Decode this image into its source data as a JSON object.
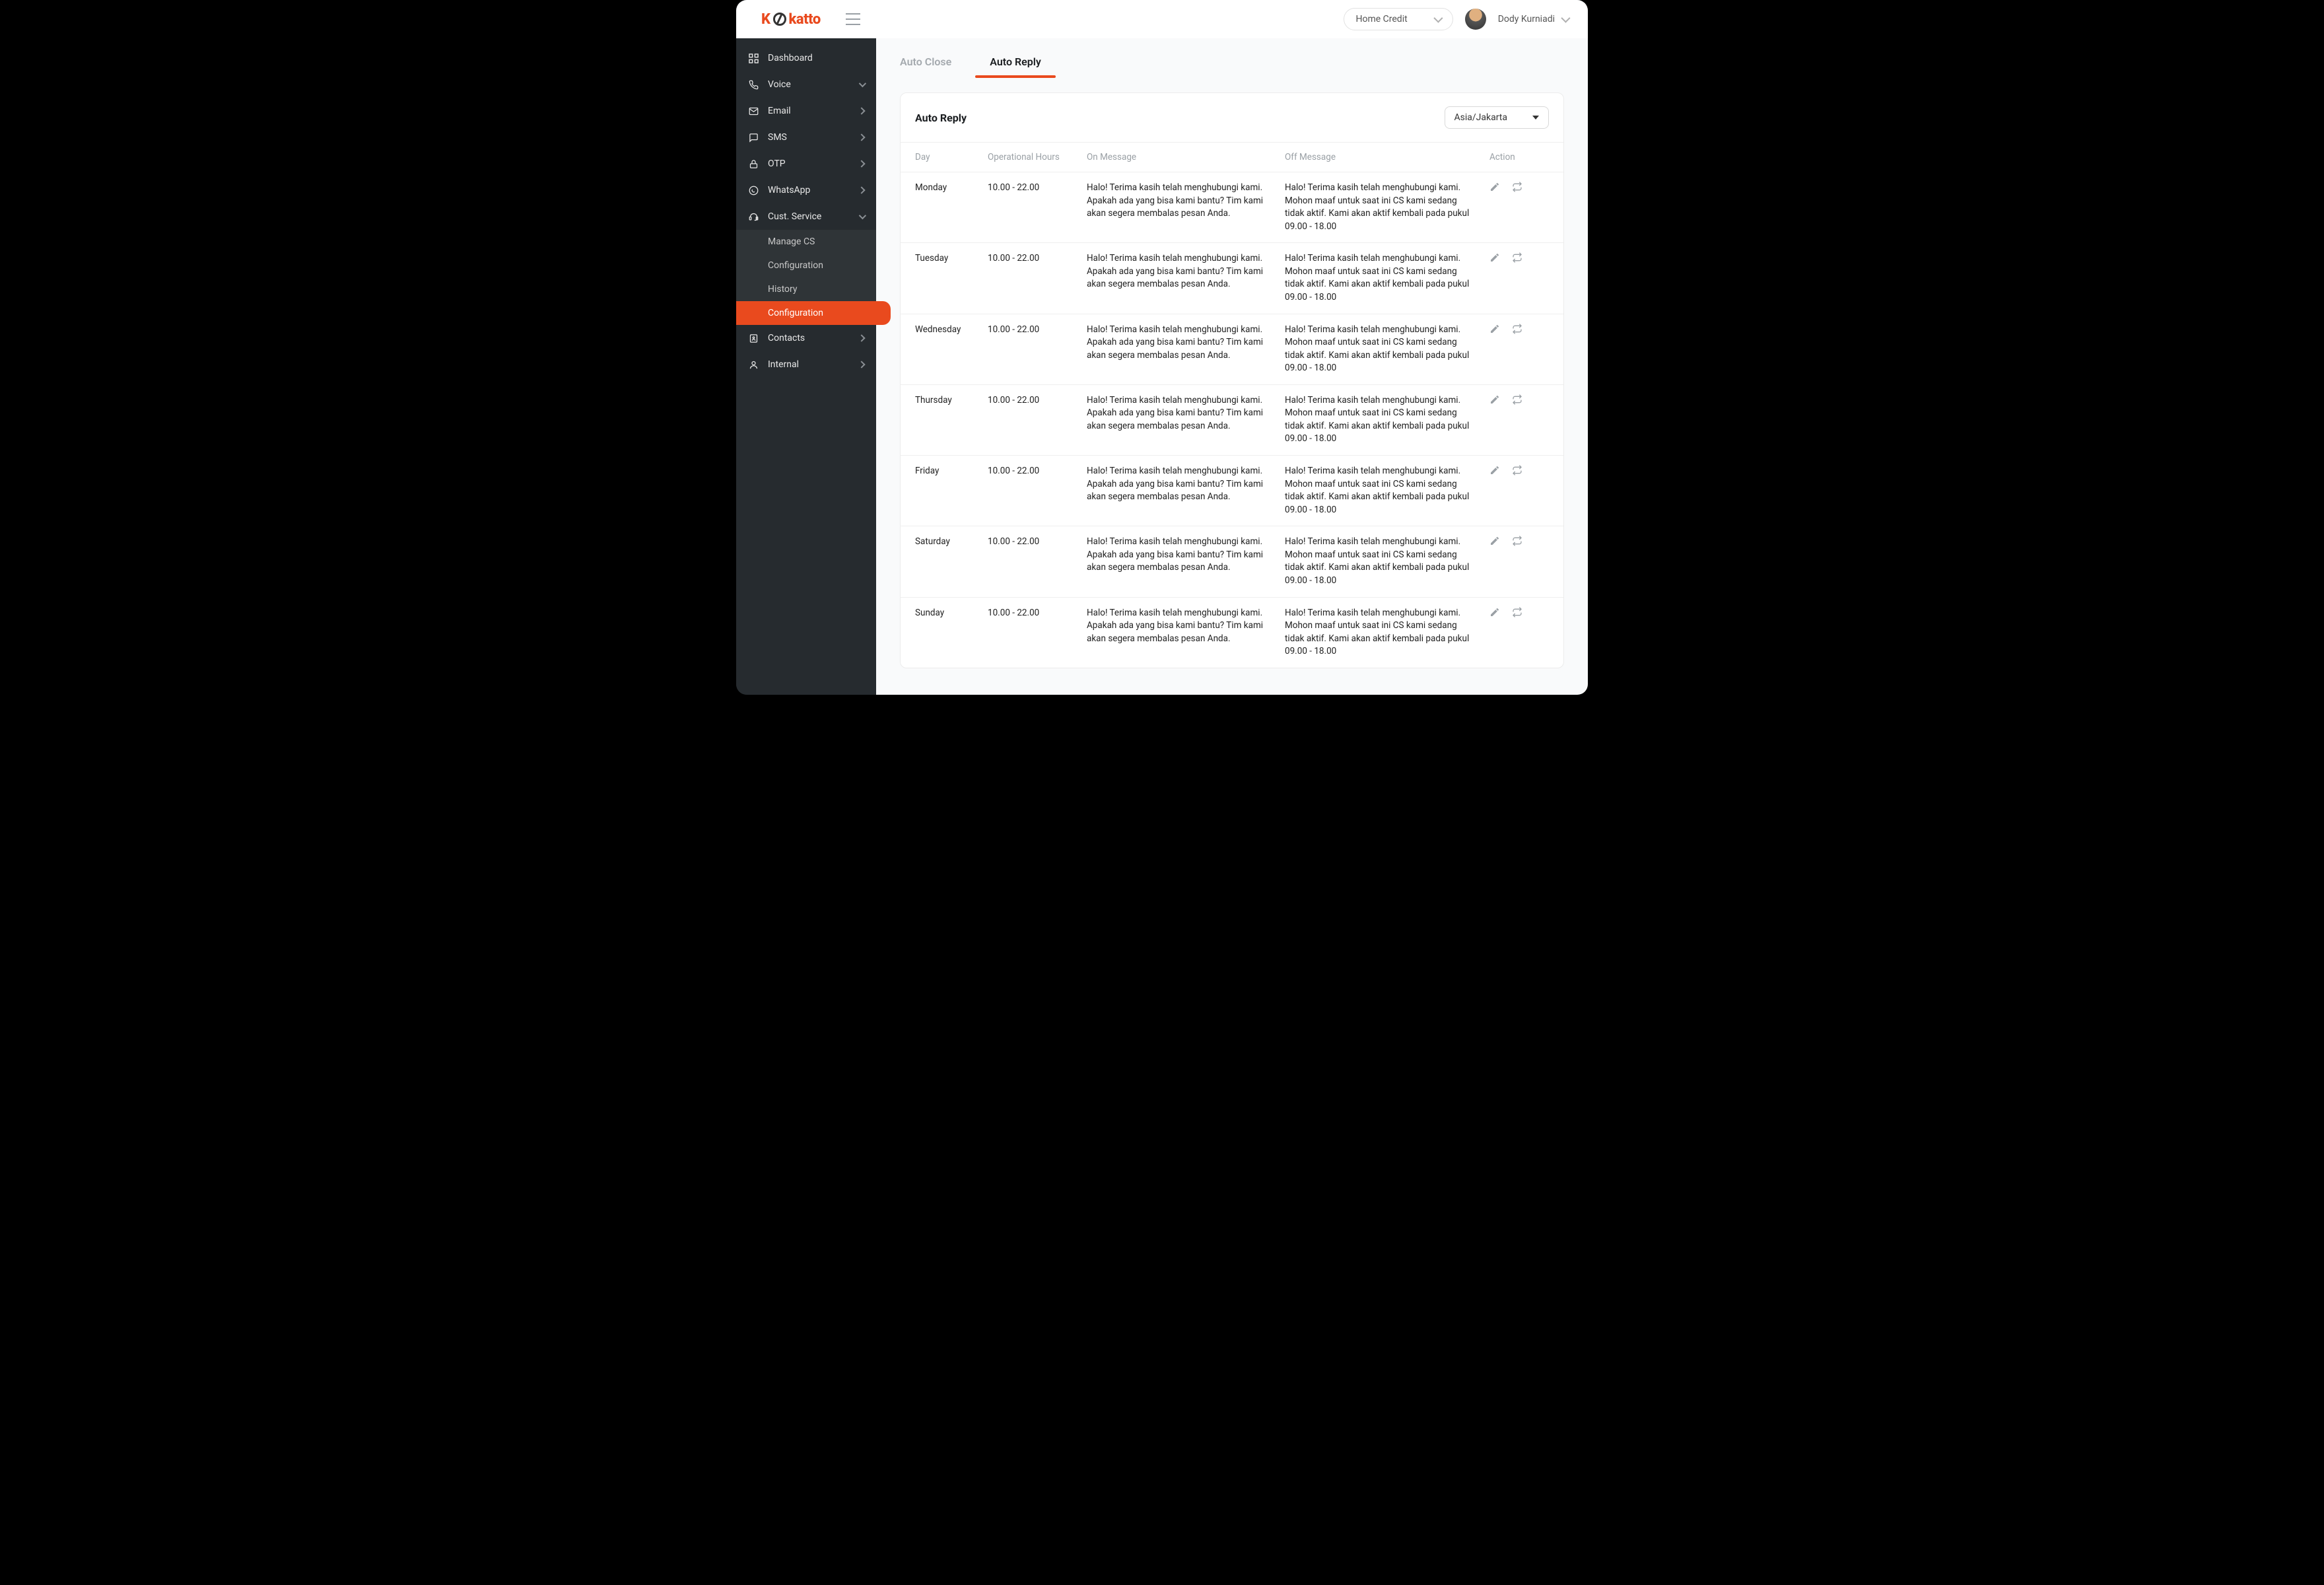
{
  "logo": {
    "k": "K",
    "rest": "katto"
  },
  "header": {
    "org": "Home Credit",
    "user": "Dody Kurniadi"
  },
  "sidebar": {
    "items": [
      {
        "label": "Dashboard",
        "icon": "grid",
        "chev": ""
      },
      {
        "label": "Voice",
        "icon": "phone",
        "chev": "d"
      },
      {
        "label": "Email",
        "icon": "mail",
        "chev": "r"
      },
      {
        "label": "SMS",
        "icon": "message",
        "chev": "r"
      },
      {
        "label": "OTP",
        "icon": "lock",
        "chev": "r"
      },
      {
        "label": "WhatsApp",
        "icon": "whatsapp",
        "chev": "r"
      },
      {
        "label": "Cust. Service",
        "icon": "headset",
        "chev": "d"
      },
      {
        "label": "Contacts",
        "icon": "contacts",
        "chev": "r"
      },
      {
        "label": "Internal",
        "icon": "user",
        "chev": "r"
      }
    ],
    "submenu": {
      "manage": "Manage CS",
      "config1": "Configuration",
      "history": "History",
      "config2": "Configuration"
    }
  },
  "tabs": {
    "auto_close": "Auto Close",
    "auto_reply": "Auto Reply"
  },
  "card": {
    "title": "Auto Reply",
    "tz": "Asia/Jakarta",
    "columns": {
      "day": "Day",
      "hours": "Operational Hours",
      "on": "On Message",
      "off": "Off Message",
      "action": "Action"
    },
    "rows": [
      {
        "day": "Monday",
        "hours": "10.00 - 22.00",
        "on": "Halo! Terima kasih telah menghubungi kami. Apakah ada yang bisa kami bantu? Tim kami akan segera membalas pesan Anda.",
        "off": "Halo! Terima kasih telah menghubungi kami. Mohon maaf untuk saat ini CS kami sedang tidak aktif. Kami akan aktif kembali pada pukul 09.00 - 18.00"
      },
      {
        "day": "Tuesday",
        "hours": "10.00 - 22.00",
        "on": "Halo! Terima kasih telah menghubungi kami. Apakah ada yang bisa kami bantu? Tim kami akan segera membalas pesan Anda.",
        "off": "Halo! Terima kasih telah menghubungi kami. Mohon maaf untuk saat ini CS kami sedang tidak aktif. Kami akan aktif kembali pada pukul 09.00 - 18.00"
      },
      {
        "day": "Wednesday",
        "hours": "10.00 - 22.00",
        "on": "Halo! Terima kasih telah menghubungi kami. Apakah ada yang bisa kami bantu? Tim kami akan segera membalas pesan Anda.",
        "off": "Halo! Terima kasih telah menghubungi kami. Mohon maaf untuk saat ini CS kami sedang tidak aktif. Kami akan aktif kembali pada pukul 09.00 - 18.00"
      },
      {
        "day": "Thursday",
        "hours": "10.00 - 22.00",
        "on": "Halo! Terima kasih telah menghubungi kami. Apakah ada yang bisa kami bantu? Tim kami akan segera membalas pesan Anda.",
        "off": "Halo! Terima kasih telah menghubungi kami. Mohon maaf untuk saat ini CS kami sedang tidak aktif. Kami akan aktif kembali pada pukul 09.00 - 18.00"
      },
      {
        "day": "Friday",
        "hours": "10.00 - 22.00",
        "on": "Halo! Terima kasih telah menghubungi kami. Apakah ada yang bisa kami bantu? Tim kami akan segera membalas pesan Anda.",
        "off": "Halo! Terima kasih telah menghubungi kami. Mohon maaf untuk saat ini CS kami sedang tidak aktif. Kami akan aktif kembali pada pukul 09.00 - 18.00"
      },
      {
        "day": "Saturday",
        "hours": "10.00 - 22.00",
        "on": "Halo! Terima kasih telah menghubungi kami. Apakah ada yang bisa kami bantu? Tim kami akan segera membalas pesan Anda.",
        "off": "Halo! Terima kasih telah menghubungi kami. Mohon maaf untuk saat ini CS kami sedang tidak aktif. Kami akan aktif kembali pada pukul 09.00 - 18.00"
      },
      {
        "day": "Sunday",
        "hours": "10.00 - 22.00",
        "on": "Halo! Terima kasih telah menghubungi kami. Apakah ada yang bisa kami bantu? Tim kami akan segera membalas pesan Anda.",
        "off": "Halo! Terima kasih telah menghubungi kami. Mohon maaf untuk saat ini CS kami sedang tidak aktif. Kami akan aktif kembali pada pukul 09.00 - 18.00"
      }
    ]
  }
}
